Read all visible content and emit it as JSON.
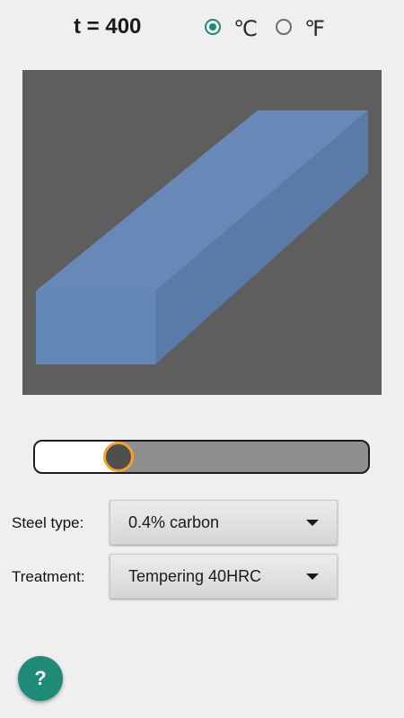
{
  "header": {
    "temperature_label": "t = 400",
    "unit_celsius": "℃",
    "unit_fahrenheit": "℉",
    "selected_unit": "celsius"
  },
  "slider": {
    "value_fraction": 0.25
  },
  "steel": {
    "label": "Steel type:",
    "value": "0.4% carbon"
  },
  "treatment": {
    "label": "Treatment:",
    "value": "Tempering 40HRC"
  },
  "help_button": {
    "label": "?"
  },
  "colors": {
    "accent": "#1f8a78",
    "thumb_ring": "#f0a22b",
    "viewport_bg": "#5e5e5e",
    "bar_front": "#6387b7",
    "bar_top": "#6888b8",
    "bar_side": "#5a7ba8"
  },
  "icons": {
    "radio_selected": "radio-checked-icon",
    "radio_unselected": "radio-unchecked-icon",
    "dropdown": "triangle-down-icon"
  }
}
